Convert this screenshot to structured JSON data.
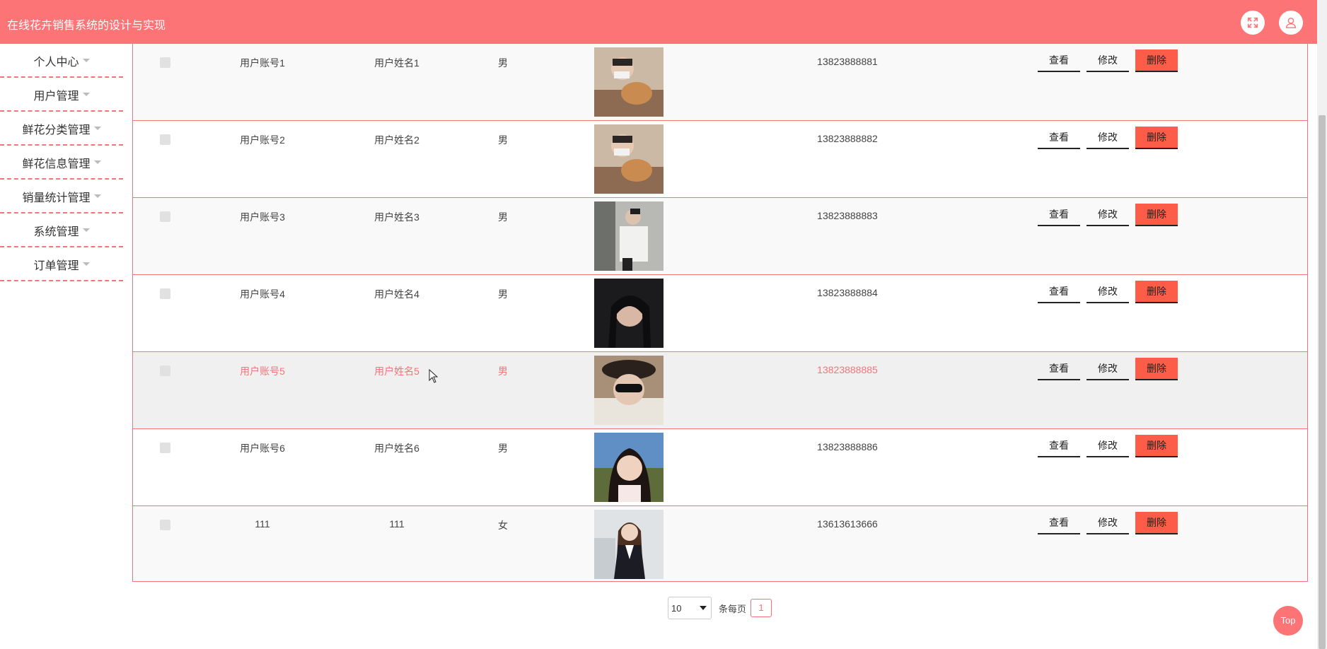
{
  "header": {
    "title": "在线花卉销售系统的设计与实现",
    "bg_color": "#fd7476",
    "icons": [
      "fullscreen-icon",
      "user-icon"
    ]
  },
  "sidebar": {
    "items": [
      {
        "label": "个人中心"
      },
      {
        "label": "用户管理"
      },
      {
        "label": "鲜花分类管理"
      },
      {
        "label": "鲜花信息管理"
      },
      {
        "label": "销量统计管理"
      },
      {
        "label": "系统管理"
      },
      {
        "label": "订单管理"
      }
    ]
  },
  "table": {
    "accent_color": "#f3747a",
    "rows": [
      {
        "account": "用户账号1",
        "name": "用户姓名1",
        "gender": "男",
        "phone": "13823888881",
        "photo": "avatar-photo"
      },
      {
        "account": "用户账号2",
        "name": "用户姓名2",
        "gender": "男",
        "phone": "13823888882",
        "photo": "avatar-photo"
      },
      {
        "account": "用户账号3",
        "name": "用户姓名3",
        "gender": "男",
        "phone": "13823888883",
        "photo": "avatar-photo"
      },
      {
        "account": "用户账号4",
        "name": "用户姓名4",
        "gender": "男",
        "phone": "13823888884",
        "photo": "avatar-photo"
      },
      {
        "account": "用户账号5",
        "name": "用户姓名5",
        "gender": "男",
        "phone": "13823888885",
        "photo": "avatar-photo"
      },
      {
        "account": "用户账号6",
        "name": "用户姓名6",
        "gender": "男",
        "phone": "13823888886",
        "photo": "avatar-photo"
      },
      {
        "account": "111",
        "name": "111",
        "gender": "女",
        "phone": "13613613666",
        "photo": "avatar-photo"
      }
    ],
    "actions": {
      "view": "查看",
      "edit": "修改",
      "delete": "删除"
    },
    "delete_color": "#fd5d48"
  },
  "pagination": {
    "page_size": "10",
    "per_page_label": "条每页",
    "current_page": "1"
  },
  "back_to_top": {
    "label": "Top"
  }
}
